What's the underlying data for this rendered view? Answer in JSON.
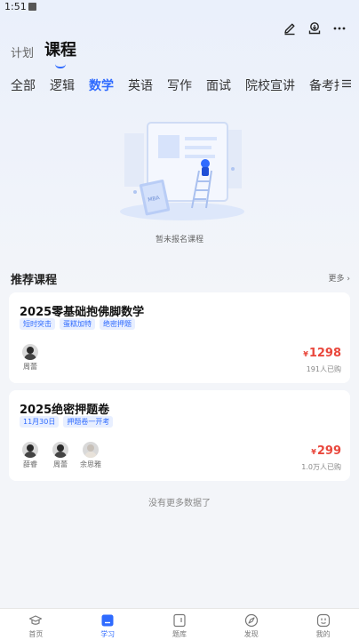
{
  "status_bar": {
    "time": "1:51"
  },
  "header": {
    "tabs": [
      {
        "label": "计划",
        "active": false
      },
      {
        "label": "课程",
        "active": true
      }
    ]
  },
  "top_icons": [
    "edit-icon",
    "download-icon",
    "more-icon"
  ],
  "subject_tabs": [
    {
      "label": "全部",
      "active": false
    },
    {
      "label": "逻辑",
      "active": false
    },
    {
      "label": "数学",
      "active": true
    },
    {
      "label": "英语",
      "active": false
    },
    {
      "label": "写作",
      "active": false
    },
    {
      "label": "面试",
      "active": false
    },
    {
      "label": "院校宣讲",
      "active": false
    },
    {
      "label": "备考指导",
      "active": false
    }
  ],
  "empty_state": {
    "text": "暂未报名课程",
    "illustration_label": "MBA"
  },
  "recommended": {
    "title": "推荐课程",
    "more": "更多 ›",
    "courses": [
      {
        "title": "2025零基础抱佛脚数学",
        "tags": [
          "短时突击",
          "蛋糕加特",
          "绝密押题"
        ],
        "teachers": [
          {
            "name": "周蕾"
          }
        ],
        "price_symbol": "¥",
        "price": "1298",
        "buyers": "191人已购"
      },
      {
        "title": "2025绝密押题卷",
        "tags": [
          "11月30日",
          "押题卷一开考"
        ],
        "teachers": [
          {
            "name": "薛睿"
          },
          {
            "name": "周蕾"
          },
          {
            "name": "余思雅"
          }
        ],
        "price_symbol": "¥",
        "price": "299",
        "buyers": "1.0万人已购"
      }
    ]
  },
  "no_more_text": "没有更多数据了",
  "bottom_nav": [
    {
      "label": "首页",
      "icon": "graduation-cap-icon",
      "active": false
    },
    {
      "label": "学习",
      "icon": "study-icon",
      "active": true
    },
    {
      "label": "题库",
      "icon": "question-bank-icon",
      "active": false
    },
    {
      "label": "发现",
      "icon": "discover-icon",
      "active": false
    },
    {
      "label": "我的",
      "icon": "profile-icon",
      "active": false
    }
  ],
  "colors": {
    "accent": "#2f6bff",
    "price": "#e9473c",
    "background": "#f3f5f9"
  }
}
